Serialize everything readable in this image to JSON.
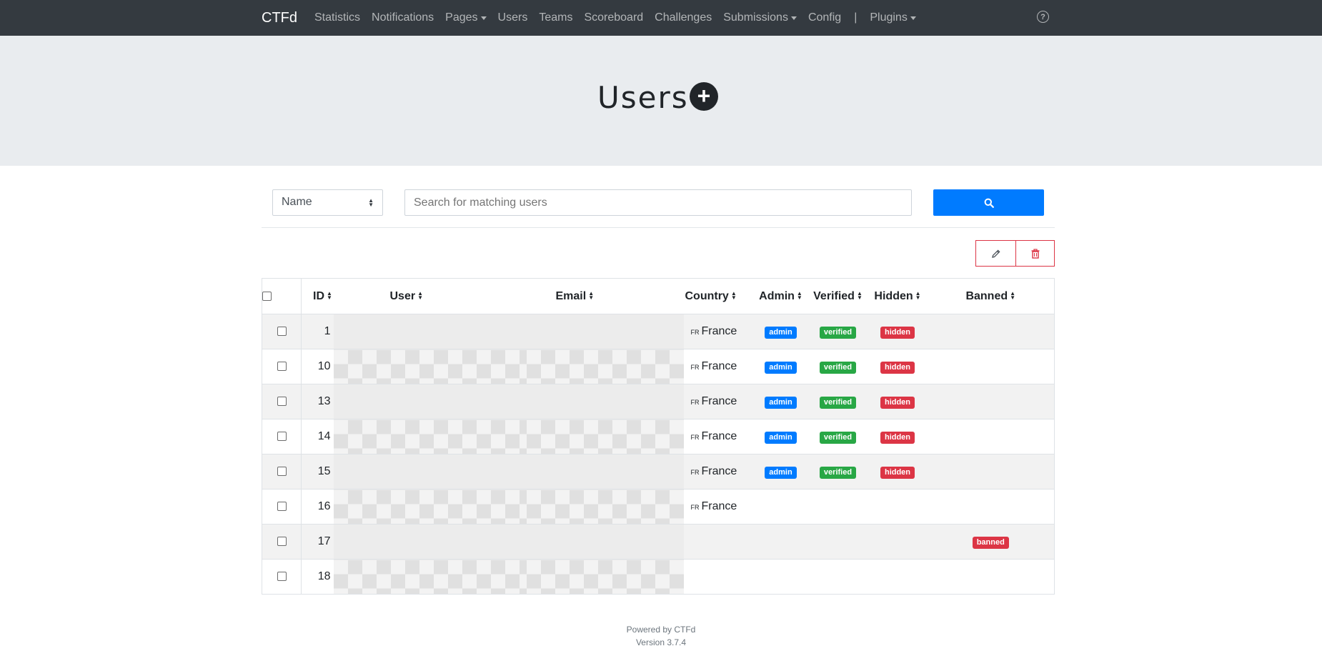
{
  "navbar": {
    "brand": "CTFd",
    "items": [
      {
        "label": "Statistics",
        "dropdown": false
      },
      {
        "label": "Notifications",
        "dropdown": false
      },
      {
        "label": "Pages",
        "dropdown": true
      },
      {
        "label": "Users",
        "dropdown": false
      },
      {
        "label": "Teams",
        "dropdown": false
      },
      {
        "label": "Scoreboard",
        "dropdown": false
      },
      {
        "label": "Challenges",
        "dropdown": false
      },
      {
        "label": "Submissions",
        "dropdown": true
      },
      {
        "label": "Config",
        "dropdown": false
      }
    ],
    "separator": "|",
    "plugins": "Plugins",
    "help_icon": "question-circle-icon"
  },
  "header": {
    "title": "Users",
    "add_icon": "plus-circle-icon"
  },
  "search": {
    "field_selected": "Name",
    "placeholder": "Search for matching users",
    "button_icon": "search-icon"
  },
  "bulk_actions": {
    "edit_icon": "pencil-icon",
    "delete_icon": "trash-icon"
  },
  "table": {
    "headers": {
      "id": "ID",
      "user": "User",
      "email": "Email",
      "country": "Country",
      "admin": "Admin",
      "verified": "Verified",
      "hidden": "Hidden",
      "banned": "Banned"
    },
    "rows": [
      {
        "id": "1",
        "country_code": "FR",
        "country": "France",
        "admin": "admin",
        "verified": "verified",
        "hidden": "hidden",
        "banned": ""
      },
      {
        "id": "10",
        "country_code": "FR",
        "country": "France",
        "admin": "admin",
        "verified": "verified",
        "hidden": "hidden",
        "banned": ""
      },
      {
        "id": "13",
        "country_code": "FR",
        "country": "France",
        "admin": "admin",
        "verified": "verified",
        "hidden": "hidden",
        "banned": ""
      },
      {
        "id": "14",
        "country_code": "FR",
        "country": "France",
        "admin": "admin",
        "verified": "verified",
        "hidden": "hidden",
        "banned": ""
      },
      {
        "id": "15",
        "country_code": "FR",
        "country": "France",
        "admin": "admin",
        "verified": "verified",
        "hidden": "hidden",
        "banned": ""
      },
      {
        "id": "16",
        "country_code": "FR",
        "country": "France",
        "admin": "",
        "verified": "",
        "hidden": "",
        "banned": ""
      },
      {
        "id": "17",
        "country_code": "",
        "country": "",
        "admin": "",
        "verified": "",
        "hidden": "",
        "banned": "banned"
      },
      {
        "id": "18",
        "country_code": "",
        "country": "",
        "admin": "",
        "verified": "",
        "hidden": "",
        "banned": ""
      }
    ]
  },
  "footer": {
    "powered": "Powered by CTFd",
    "version": "Version 3.7.4"
  },
  "colors": {
    "navbar": "#343a40",
    "primary": "#007bff",
    "success": "#28a745",
    "danger": "#dc3545"
  }
}
